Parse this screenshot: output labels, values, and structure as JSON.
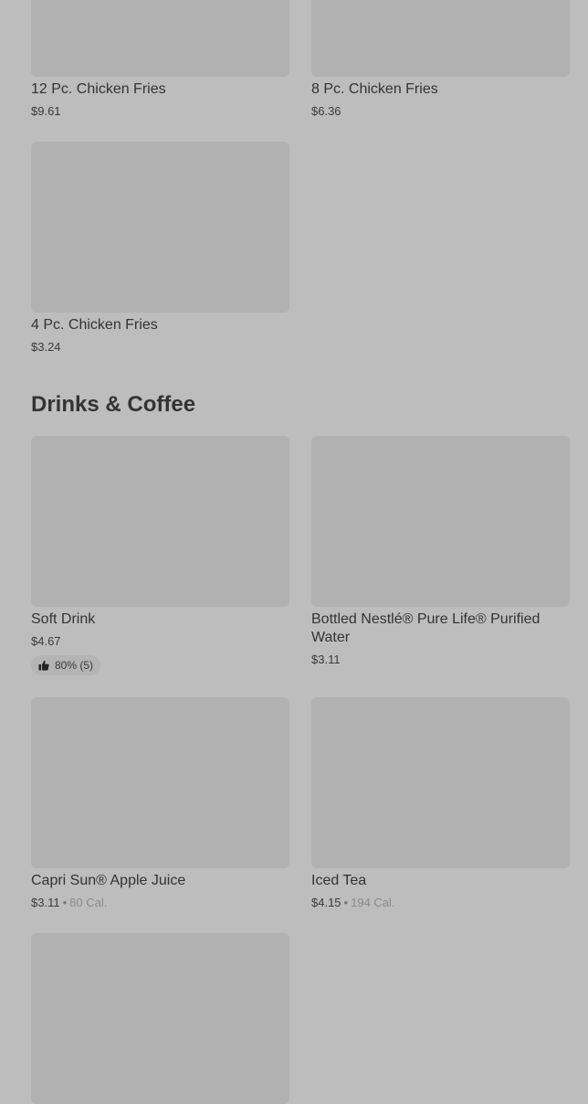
{
  "top_items": [
    {
      "name": "12 Pc. Chicken Fries",
      "price": "$9.61"
    },
    {
      "name": "8 Pc. Chicken Fries",
      "price": "$6.36"
    },
    {
      "name": "4 Pc. Chicken Fries",
      "price": "$3.24"
    }
  ],
  "drinks_section": {
    "title": "Drinks & Coffee",
    "items": [
      {
        "name": "Soft Drink",
        "price": "$4.67",
        "rating": "80% (5)"
      },
      {
        "name": "Bottled Nestlé® Pure Life® Purified Water",
        "price": "$3.11"
      },
      {
        "name": "Capri Sun® Apple Juice",
        "price": "$3.11",
        "separator": "•",
        "calories": "80 Cal."
      },
      {
        "name": "Iced Tea",
        "price": "$4.15",
        "separator": "•",
        "calories": "194 Cal."
      }
    ]
  },
  "icons": {
    "rating": "thumbs-up-icon"
  }
}
